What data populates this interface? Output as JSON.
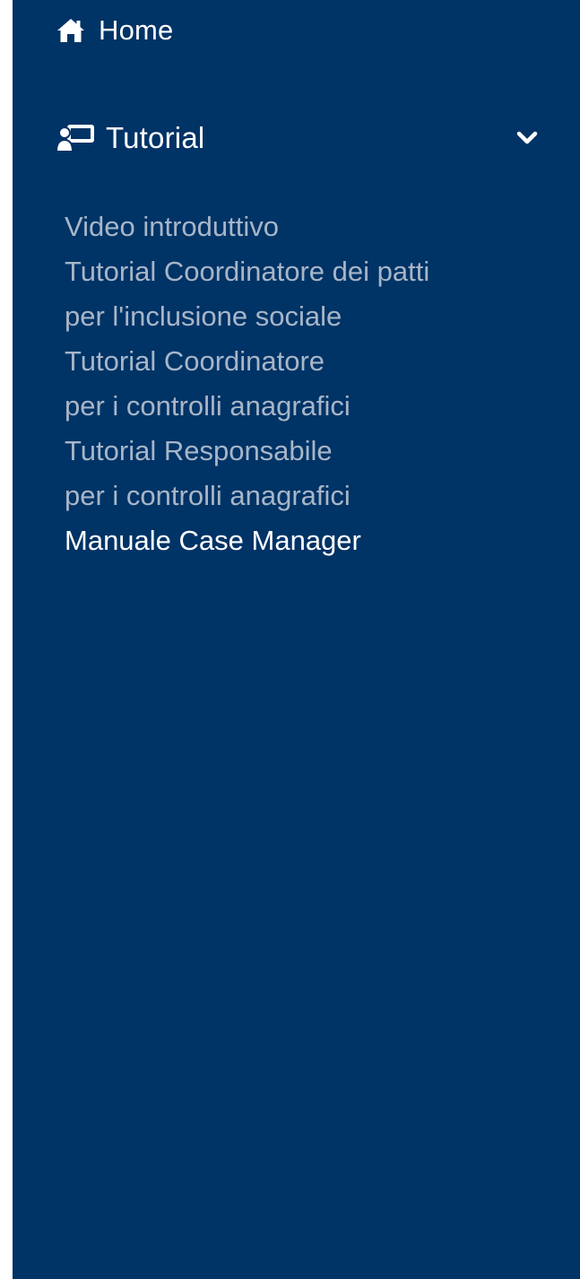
{
  "colors": {
    "sidebar_background": "#003366",
    "active_text": "#ffffff",
    "inactive_text": "#a7b6c8"
  },
  "nav": {
    "home": {
      "label": "Home",
      "icon": "home-icon"
    },
    "tutorial": {
      "label": "Tutorial",
      "icon": "presentation-icon",
      "expanded_icon": "chevron-down-icon",
      "items": [
        {
          "lines": [
            "Video introduttivo"
          ]
        },
        {
          "lines": [
            "Tutorial Coordinatore dei patti",
            "per l'inclusione sociale"
          ]
        },
        {
          "lines": [
            "Tutorial Coordinatore",
            "per i controlli anagrafici"
          ]
        },
        {
          "lines": [
            "Tutorial Responsabile",
            "per i controlli anagrafici"
          ]
        },
        {
          "lines": [
            "Manuale Case Manager"
          ],
          "active": true
        }
      ]
    }
  }
}
